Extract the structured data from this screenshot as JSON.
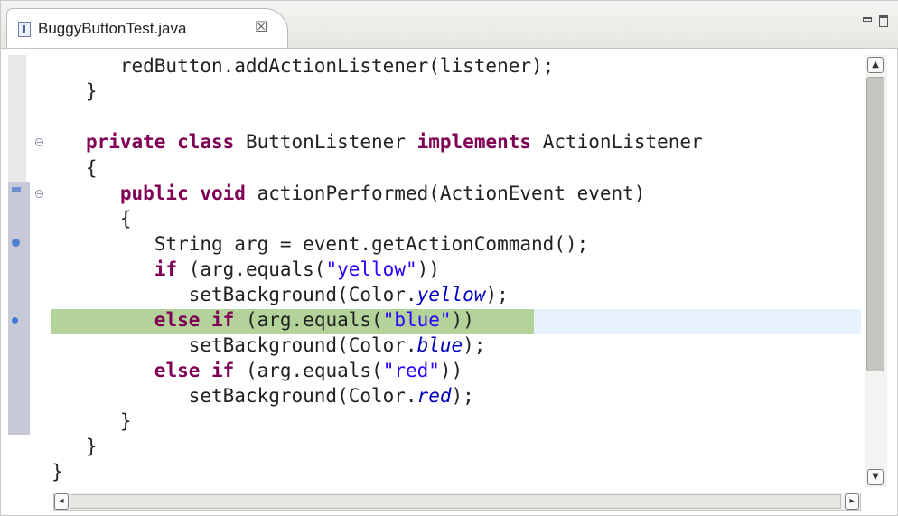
{
  "editor": {
    "tab": {
      "file_icon": "J",
      "title": "BuggyButtonTest.java",
      "close_glyph": "☒"
    },
    "view_controls": [
      "minimize",
      "maximize"
    ],
    "colors": {
      "keyword": "#7f0055",
      "string": "#2a00ff",
      "field": "#0000c0",
      "current_line": "#e8f2fe",
      "debug_highlight": "#b3d39b"
    },
    "code_lines": [
      {
        "segments": [
          {
            "t": "      redButton.addActionListener(listener);",
            "c": ""
          }
        ]
      },
      {
        "segments": [
          {
            "t": "   }",
            "c": ""
          }
        ]
      },
      {
        "segments": [
          {
            "t": "",
            "c": ""
          }
        ]
      },
      {
        "segments": [
          {
            "t": "   ",
            "c": ""
          },
          {
            "t": "private class",
            "c": "kw"
          },
          {
            "t": " ButtonListener ",
            "c": ""
          },
          {
            "t": "implements",
            "c": "kw"
          },
          {
            "t": " ActionListener",
            "c": ""
          }
        ]
      },
      {
        "segments": [
          {
            "t": "   {",
            "c": ""
          }
        ]
      },
      {
        "segments": [
          {
            "t": "      ",
            "c": ""
          },
          {
            "t": "public void",
            "c": "kw"
          },
          {
            "t": " actionPerformed(ActionEvent event)",
            "c": ""
          }
        ]
      },
      {
        "segments": [
          {
            "t": "      {",
            "c": ""
          }
        ]
      },
      {
        "segments": [
          {
            "t": "         String arg = event.getActionCommand();",
            "c": ""
          }
        ]
      },
      {
        "segments": [
          {
            "t": "         ",
            "c": ""
          },
          {
            "t": "if",
            "c": "kw"
          },
          {
            "t": " (arg.equals(",
            "c": ""
          },
          {
            "t": "\"yellow\"",
            "c": "str"
          },
          {
            "t": "))",
            "c": ""
          }
        ]
      },
      {
        "segments": [
          {
            "t": "            setBackground(Color.",
            "c": ""
          },
          {
            "t": "yellow",
            "c": "fld"
          },
          {
            "t": ");",
            "c": ""
          }
        ]
      },
      {
        "segments": [
          {
            "t": "         ",
            "c": ""
          },
          {
            "t": "else if",
            "c": "kw"
          },
          {
            "t": " (arg.equals(",
            "c": ""
          },
          {
            "t": "\"blue\"",
            "c": "str"
          },
          {
            "t": "))",
            "c": ""
          }
        ]
      },
      {
        "segments": [
          {
            "t": "            setBackground(Color.",
            "c": ""
          },
          {
            "t": "blue",
            "c": "fld"
          },
          {
            "t": ");",
            "c": ""
          }
        ]
      },
      {
        "segments": [
          {
            "t": "         ",
            "c": ""
          },
          {
            "t": "else if",
            "c": "kw"
          },
          {
            "t": " (arg.equals(",
            "c": ""
          },
          {
            "t": "\"red\"",
            "c": "str"
          },
          {
            "t": "))",
            "c": ""
          }
        ]
      },
      {
        "segments": [
          {
            "t": "            setBackground(Color.",
            "c": ""
          },
          {
            "t": "red",
            "c": "fld"
          },
          {
            "t": ");",
            "c": ""
          }
        ]
      },
      {
        "segments": [
          {
            "t": "      }",
            "c": ""
          }
        ]
      },
      {
        "segments": [
          {
            "t": "   }",
            "c": ""
          }
        ]
      },
      {
        "segments": [
          {
            "t": "}",
            "c": ""
          }
        ]
      }
    ],
    "highlighted_line_index": 10,
    "scrollbars": {
      "up_arrow": "▲",
      "down_arrow": "▼",
      "left_arrow": "◂",
      "right_arrow": "▸"
    }
  }
}
